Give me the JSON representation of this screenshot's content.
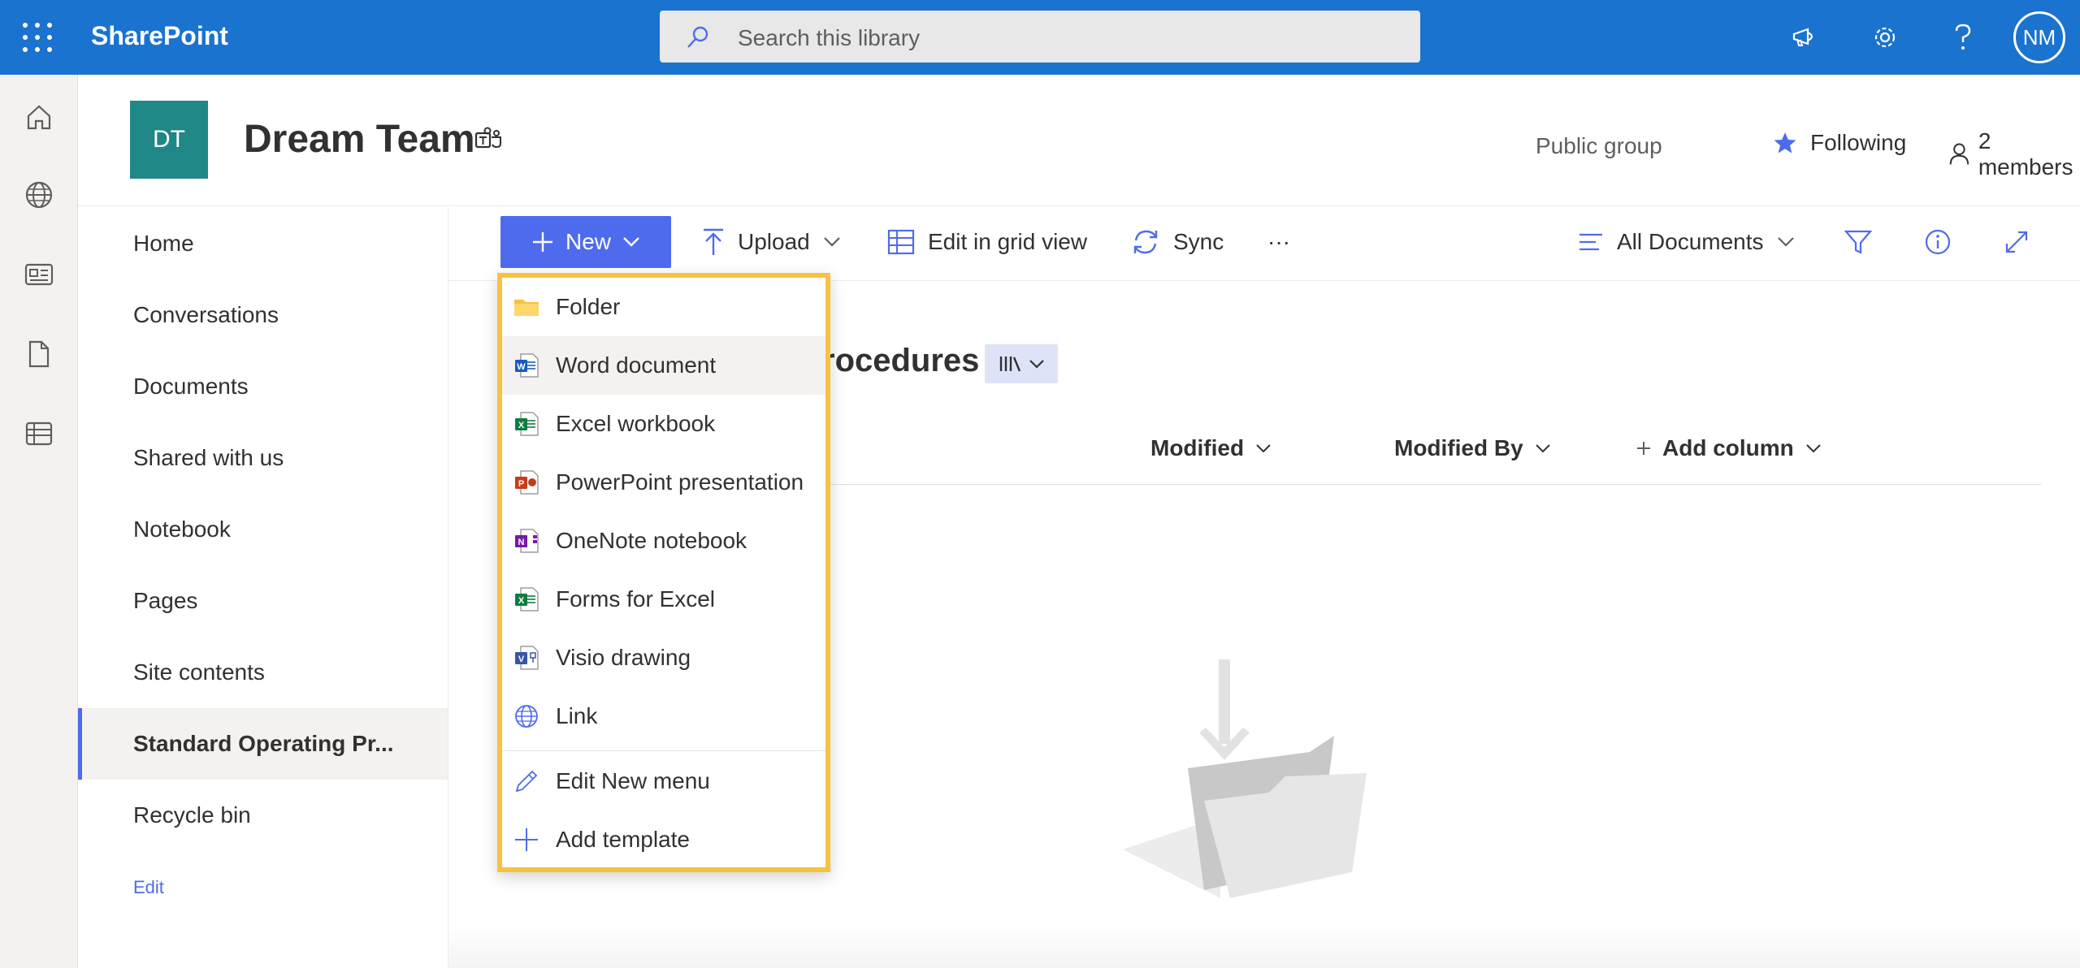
{
  "suite": {
    "app_name": "SharePoint",
    "search_placeholder": "Search this library",
    "avatar_initials": "NM"
  },
  "site": {
    "logo_initials": "DT",
    "title": "Dream Team",
    "group_type": "Public group",
    "following_label": "Following",
    "members_label": "2 members"
  },
  "nav": {
    "items": [
      {
        "label": "Home"
      },
      {
        "label": "Conversations"
      },
      {
        "label": "Documents"
      },
      {
        "label": "Shared with us"
      },
      {
        "label": "Notebook"
      },
      {
        "label": "Pages"
      },
      {
        "label": "Site contents"
      },
      {
        "label": "Standard Operating Pr...",
        "selected": true
      },
      {
        "label": "Recycle bin"
      }
    ],
    "edit_label": "Edit"
  },
  "command_bar": {
    "new_label": "New",
    "upload_label": "Upload",
    "grid_label": "Edit in grid view",
    "sync_label": "Sync",
    "more_label": "···",
    "view_label": "All Documents"
  },
  "library": {
    "title_visible": "rocedures",
    "columns": {
      "modified": "Modified",
      "modified_by": "Modified By",
      "add_column": "Add column"
    }
  },
  "new_menu": {
    "items": [
      {
        "label": "Folder",
        "icon": "folder-icon"
      },
      {
        "label": "Word document",
        "icon": "word-icon",
        "hover": true
      },
      {
        "label": "Excel workbook",
        "icon": "excel-icon"
      },
      {
        "label": "PowerPoint presentation",
        "icon": "powerpoint-icon"
      },
      {
        "label": "OneNote notebook",
        "icon": "onenote-icon"
      },
      {
        "label": "Forms for Excel",
        "icon": "forms-excel-icon"
      },
      {
        "label": "Visio drawing",
        "icon": "visio-icon"
      },
      {
        "label": "Link",
        "icon": "globe-icon"
      }
    ],
    "footer_items": [
      {
        "label": "Edit New menu",
        "icon": "pencil-icon"
      },
      {
        "label": "Add template",
        "icon": "plus-icon"
      }
    ]
  },
  "colors": {
    "suite_bar": "#1a73cf",
    "accent": "#4f6bed",
    "site_logo": "#1f8785",
    "highlight_border": "#f7c242"
  }
}
